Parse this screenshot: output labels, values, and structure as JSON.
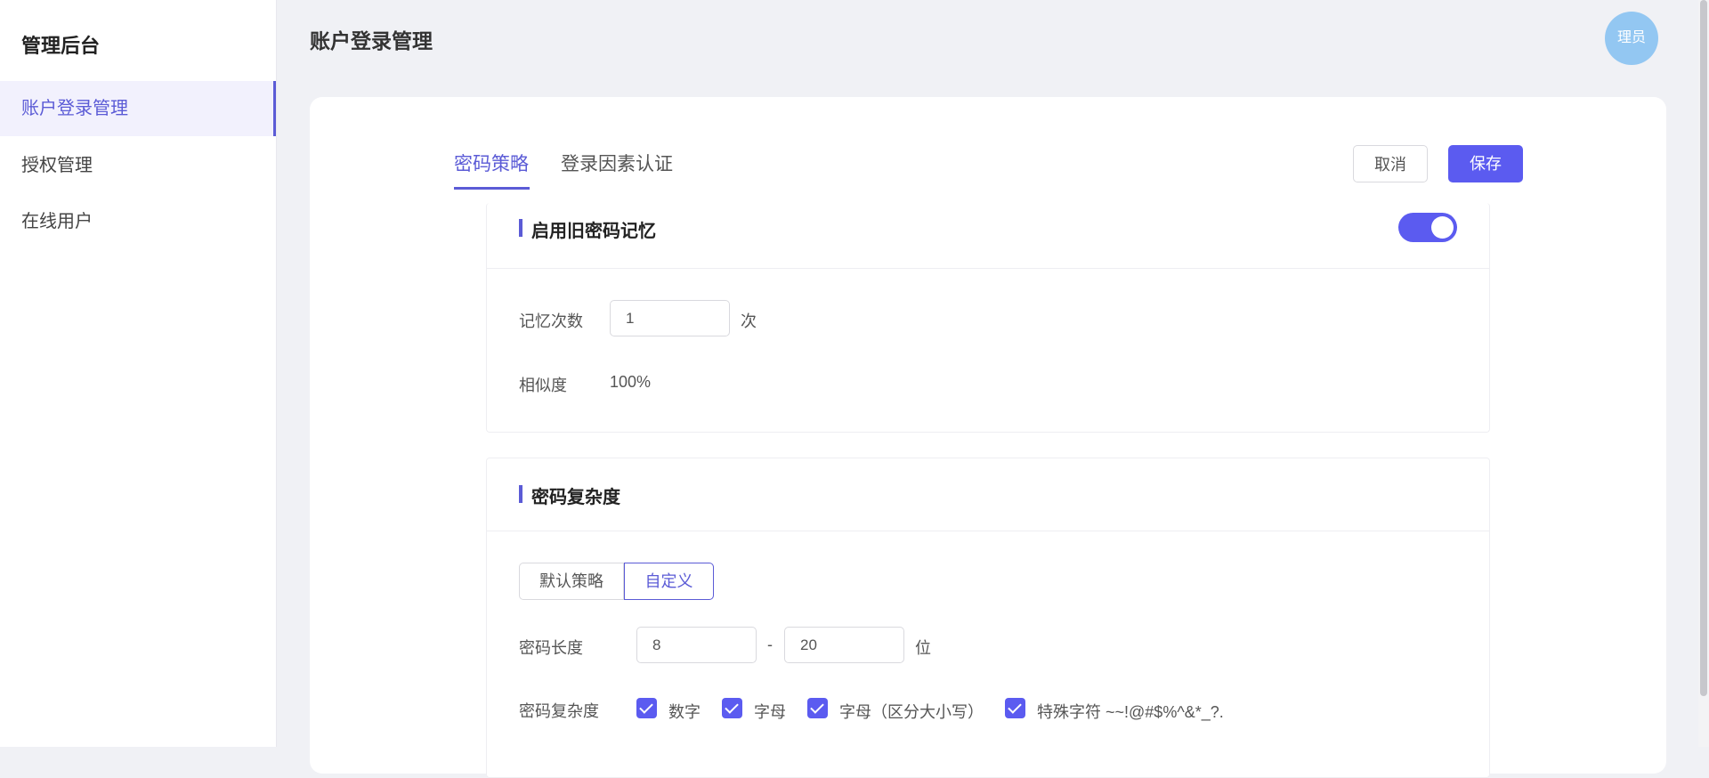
{
  "sidebar": {
    "brand": "管理后台",
    "items": [
      {
        "label": "账户登录管理"
      },
      {
        "label": "授权管理"
      },
      {
        "label": "在线用户"
      }
    ]
  },
  "header": {
    "title": "账户登录管理",
    "avatar_text": "理员"
  },
  "tabs": [
    {
      "label": "密码策略"
    },
    {
      "label": "登录因素认证"
    }
  ],
  "actions": {
    "cancel": "取消",
    "save": "保存"
  },
  "password_history": {
    "title": "启用旧密码记忆",
    "enabled": true,
    "count_label": "记忆次数",
    "count_value": "1",
    "count_unit": "次",
    "similarity_label": "相似度",
    "similarity_value": "100%"
  },
  "complexity": {
    "title": "密码复杂度",
    "mode_default": "默认策略",
    "mode_custom": "自定义",
    "selected_mode": "自定义",
    "length_label": "密码长度",
    "length_min": "8",
    "length_sep": "-",
    "length_max": "20",
    "length_unit": "位",
    "rules_label": "密码复杂度",
    "rules": [
      {
        "label": "数字",
        "checked": true
      },
      {
        "label": "字母",
        "checked": true
      },
      {
        "label": "字母（区分大小写）",
        "checked": true
      },
      {
        "label": "特殊字符 ~~!@#$%^&*_?.",
        "checked": true
      }
    ]
  },
  "colors": {
    "accent": "#5b5bd6",
    "primary_button": "#5b5bf0",
    "avatar": "#93c7f2"
  }
}
